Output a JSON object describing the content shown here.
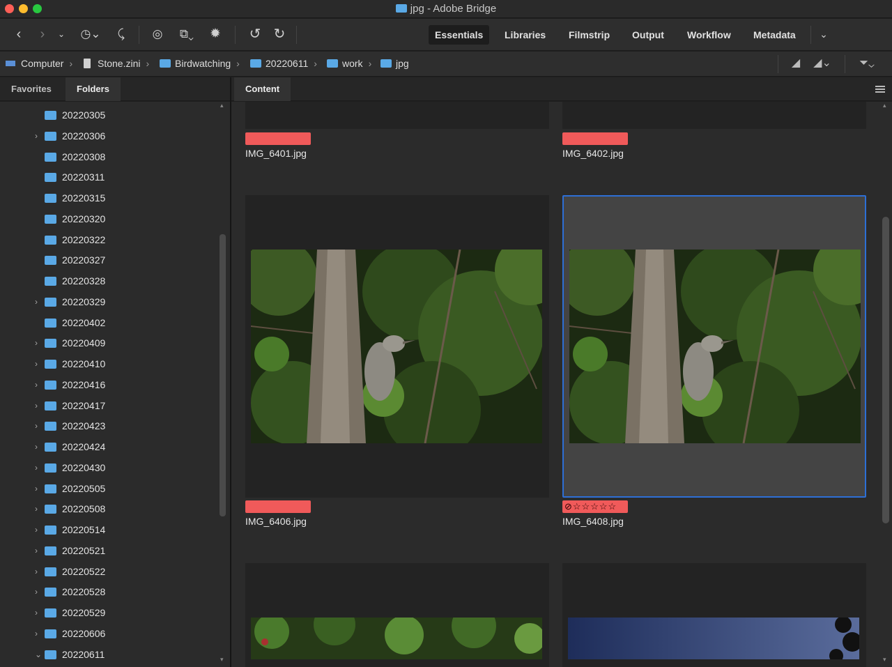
{
  "window": {
    "title": "jpg - Adobe Bridge"
  },
  "toolbar": {
    "icons": [
      "back-icon",
      "forward-icon",
      "dropdown-icon",
      "recent-icon",
      "boomerang-icon",
      "camera-import-icon",
      "copy-icon",
      "refine-icon",
      "undo-icon",
      "redo-icon"
    ]
  },
  "workspaces": [
    "Essentials",
    "Libraries",
    "Filmstrip",
    "Output",
    "Workflow",
    "Metadata"
  ],
  "active_workspace": "Essentials",
  "breadcrumb": [
    {
      "label": "Computer"
    },
    {
      "label": "Stone.zini"
    },
    {
      "label": "Birdwatching"
    },
    {
      "label": "20220611"
    },
    {
      "label": "work"
    },
    {
      "label": "jpg"
    }
  ],
  "left_panel": {
    "tabs": [
      "Favorites",
      "Folders"
    ],
    "active_tab": "Folders",
    "folders": [
      {
        "name": "20220305",
        "has_children": false,
        "expanded": false
      },
      {
        "name": "20220306",
        "has_children": true,
        "expanded": false
      },
      {
        "name": "20220308",
        "has_children": false,
        "expanded": false
      },
      {
        "name": "20220311",
        "has_children": false,
        "expanded": false
      },
      {
        "name": "20220315",
        "has_children": false,
        "expanded": false
      },
      {
        "name": "20220320",
        "has_children": false,
        "expanded": false
      },
      {
        "name": "20220322",
        "has_children": false,
        "expanded": false
      },
      {
        "name": "20220327",
        "has_children": false,
        "expanded": false
      },
      {
        "name": "20220328",
        "has_children": false,
        "expanded": false
      },
      {
        "name": "20220329",
        "has_children": true,
        "expanded": false
      },
      {
        "name": "20220402",
        "has_children": false,
        "expanded": false
      },
      {
        "name": "20220409",
        "has_children": true,
        "expanded": false
      },
      {
        "name": "20220410",
        "has_children": true,
        "expanded": false
      },
      {
        "name": "20220416",
        "has_children": true,
        "expanded": false
      },
      {
        "name": "20220417",
        "has_children": true,
        "expanded": false
      },
      {
        "name": "20220423",
        "has_children": true,
        "expanded": false
      },
      {
        "name": "20220424",
        "has_children": true,
        "expanded": false
      },
      {
        "name": "20220430",
        "has_children": true,
        "expanded": false
      },
      {
        "name": "20220505",
        "has_children": true,
        "expanded": false
      },
      {
        "name": "20220508",
        "has_children": true,
        "expanded": false
      },
      {
        "name": "20220514",
        "has_children": true,
        "expanded": false
      },
      {
        "name": "20220521",
        "has_children": true,
        "expanded": false
      },
      {
        "name": "20220522",
        "has_children": true,
        "expanded": false
      },
      {
        "name": "20220528",
        "has_children": true,
        "expanded": false
      },
      {
        "name": "20220529",
        "has_children": true,
        "expanded": false
      },
      {
        "name": "20220606",
        "has_children": true,
        "expanded": false
      },
      {
        "name": "20220611",
        "has_children": true,
        "expanded": true
      }
    ]
  },
  "content_panel": {
    "tab": "Content",
    "items": [
      {
        "filename": "IMG_6401.jpg",
        "label_color": "#f05a5a",
        "rejected": false
      },
      {
        "filename": "IMG_6402.jpg",
        "label_color": "#f05a5a",
        "rejected": false
      },
      {
        "filename": "IMG_6406.jpg",
        "label_color": "#f05a5a",
        "rejected": false
      },
      {
        "filename": "IMG_6408.jpg",
        "label_color": "#f05a5a",
        "rejected": true,
        "selected": true
      }
    ]
  },
  "colors": {
    "folder": "#5aa9e6",
    "label_red": "#f05a5a",
    "selection": "#2d6fd6"
  }
}
